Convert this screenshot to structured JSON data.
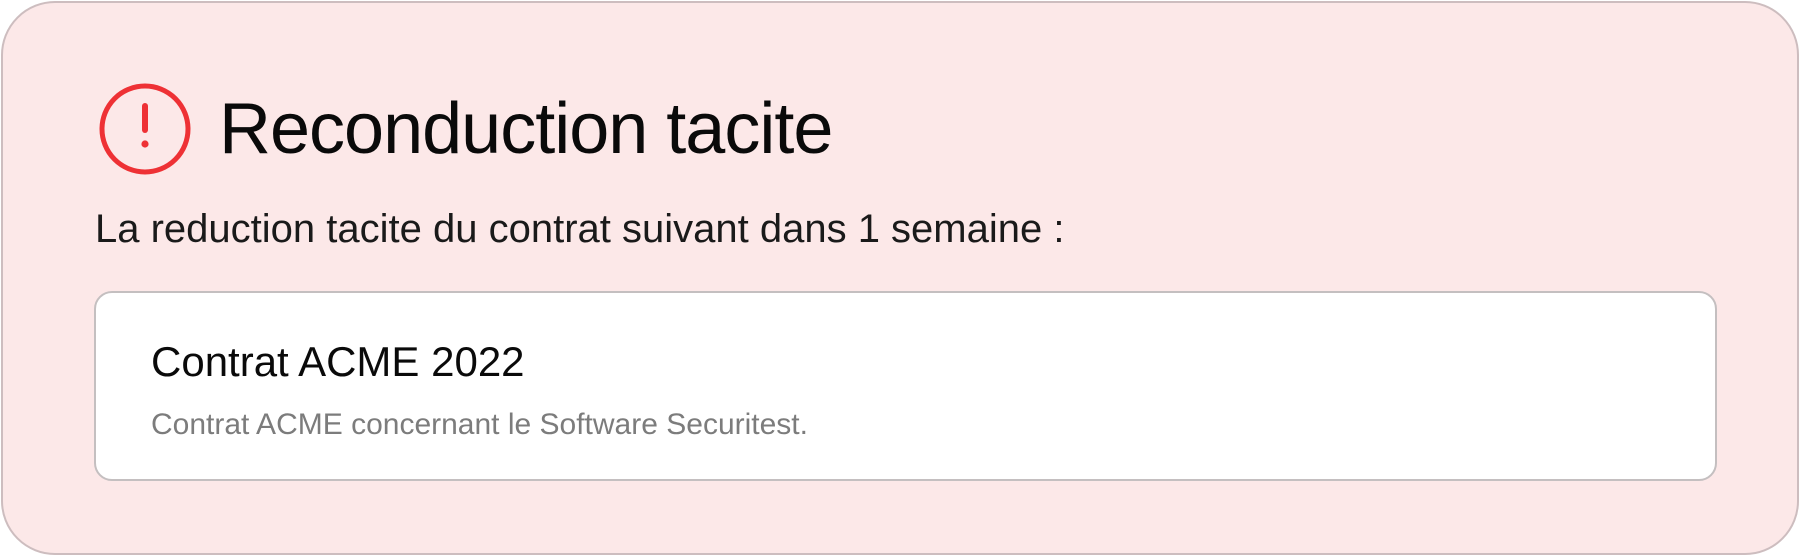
{
  "alert": {
    "icon": "exclamation-circle-icon",
    "title": "Reconduction tacite",
    "message": "La reduction tacite du contrat suivant dans 1 semaine :",
    "colors": {
      "background": "#fce8e8",
      "border": "#cdbdbf",
      "icon": "#ee3135"
    }
  },
  "contract": {
    "title": "Contrat ACME 2022",
    "description": "Contrat ACME concernant le Software Securitest."
  }
}
